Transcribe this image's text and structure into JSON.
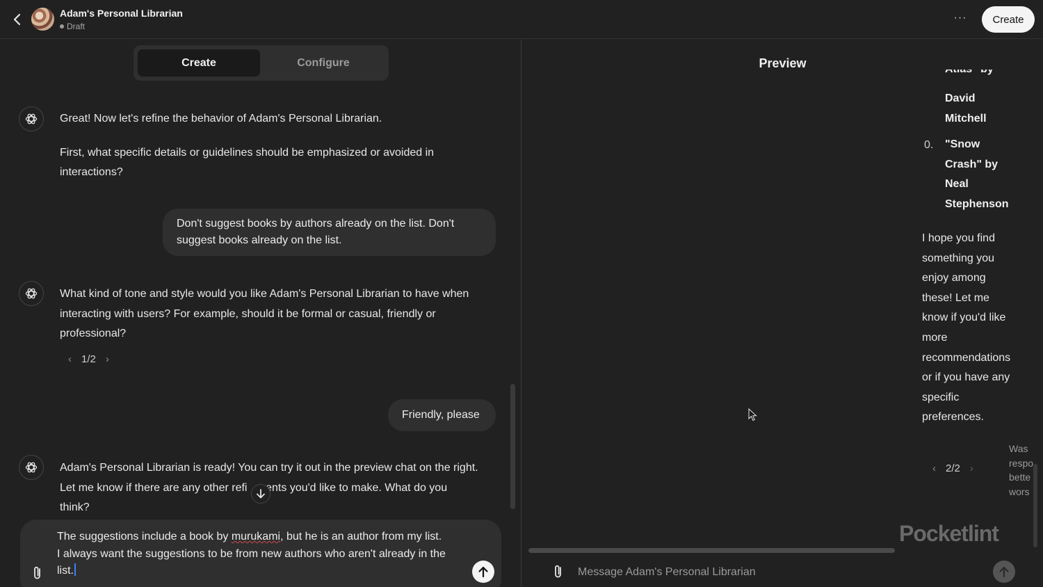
{
  "header": {
    "title": "Adam's Personal Librarian",
    "status": "Draft",
    "more_label": "···",
    "create_label": "Create"
  },
  "builder": {
    "tabs": [
      {
        "label": "Create",
        "active": true
      },
      {
        "label": "Configure",
        "active": false
      }
    ],
    "messages": {
      "bot1_p1": "Great! Now let's refine the behavior of Adam's Personal Librarian.",
      "bot1_p2_line1": "First, what specific details or guidelines should be emphasized or avoided in",
      "bot1_p2_line2": "interactions?",
      "user1_line1": "Don't suggest books by authors already on the list. Don't",
      "user1_line2": "suggest books already on the list.",
      "bot2_line1": "What kind of tone and style would you like Adam's Personal Librarian to have when",
      "bot2_line2": "interacting with users? For example, should it be formal or casual, friendly or",
      "bot2_line3": "professional?",
      "bot2_pager": "1/2",
      "user2": "Friendly, please",
      "bot3_line1": "Adam's Personal Librarian is ready! You can try it out in the preview chat on the right.",
      "bot3_line2": "Let me know if there are any other refi   ments you'd like to make. What do you",
      "bot3_line3": "think?"
    },
    "composer": {
      "line1_pre": "The suggestions include a book by ",
      "line1_misspelled": "murukami",
      "line1_post": ", but he is an author from my list.",
      "line2": "I always want the suggestions to be from new authors who aren't already in the",
      "line3": "list."
    }
  },
  "preview": {
    "title": "Preview",
    "cut_line": "Atlas\" by",
    "item_prev": [
      "David",
      "Mitchell"
    ],
    "list_number": "0.",
    "item_next": [
      "\"Snow",
      "Crash\" by",
      "Neal",
      "Stephenson"
    ],
    "closing": [
      "I hope you find",
      "something you",
      "enjoy among",
      "these! Let me",
      "know if you'd like",
      "more",
      "recommendations",
      "or if you have any",
      "specific",
      "preferences."
    ],
    "pager": "2/2",
    "feedback": [
      "Was",
      "respo",
      "bette",
      "wors"
    ],
    "input_placeholder": "Message Adam's Personal Librarian",
    "watermark": "Pocketlint"
  },
  "colors": {
    "background": "#212121",
    "bubble": "#2f2f2f",
    "accent_caret": "#3b82f6",
    "watermark_o": "#d9342b"
  },
  "icons": [
    "chevron-left-icon",
    "avatar",
    "more-icon",
    "openai-logo-icon",
    "chevron-down-arrow-icon",
    "paperclip-icon",
    "arrow-up-icon",
    "mouse-pointer-icon"
  ]
}
